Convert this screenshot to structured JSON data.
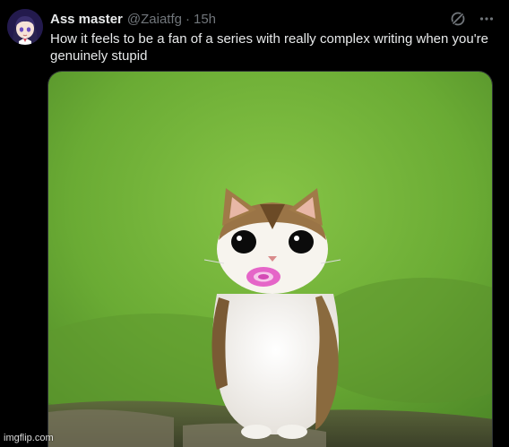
{
  "tweet": {
    "author": {
      "display_name": "Ass master",
      "handle": "@Zaiatfg",
      "avatar_icon": "anime-girl-avatar-icon"
    },
    "separator": "·",
    "timestamp": "15h",
    "text": "How it feels to be a fan of a series with really complex writing when you're genuinely stupid",
    "actions": {
      "grok_icon": "grok-icon",
      "more_icon": "more-icon"
    },
    "media": {
      "description_icon": "cat-with-pacifier-image"
    }
  },
  "watermark": "imgflip.com",
  "colors": {
    "background": "#000000",
    "text_primary": "#e7e9ea",
    "text_secondary": "#71767b",
    "border": "#2f3336"
  }
}
